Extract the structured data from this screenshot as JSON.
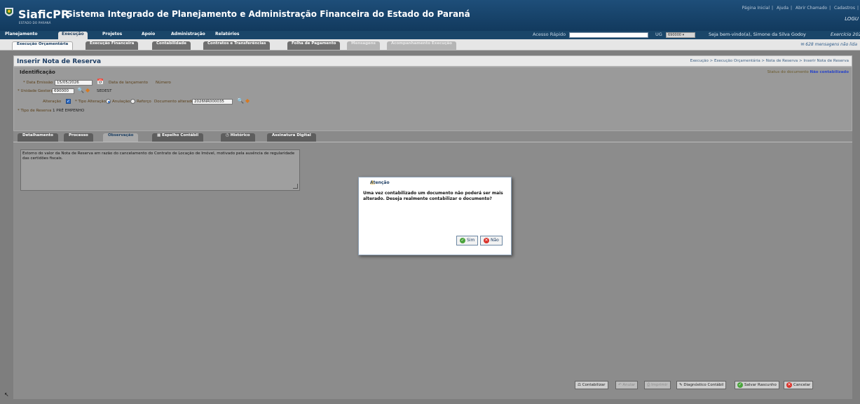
{
  "header": {
    "app_name": "SiaficPR",
    "app_subtitle": "ESTADO DO PARANÁ",
    "system_title": "Sistema Integrado de Planejamento e Administração Financeira do Estado do Paraná",
    "top_links": [
      "Página Inicial",
      "Ajuda",
      "Abrir Chamado",
      "Cadastros"
    ],
    "brand": "LOGU"
  },
  "main_nav": {
    "tabs": [
      {
        "label": "Planejamento"
      },
      {
        "label": "Execução",
        "active": true
      },
      {
        "label": "Projetos"
      },
      {
        "label": "Apoio"
      },
      {
        "label": "Administração"
      },
      {
        "label": "Relatórios"
      }
    ],
    "quick_access_label": "Acesso Rápido",
    "quick_access_value": "",
    "ug_label": "UG",
    "ug_value": "690000",
    "welcome": "Seja bem-vindo(a), Simone da Silva Godoy",
    "exercicio": "Exercício 202"
  },
  "sub_nav": {
    "tabs": [
      {
        "label": "Execução Orçamentária",
        "active": true
      },
      {
        "label": "Execução Financeira"
      },
      {
        "label": "Contabilidade"
      },
      {
        "label": "Contratos e Transferências"
      },
      {
        "label": "Folha de Pagamento"
      },
      {
        "label": "Mensagens",
        "disabled": true
      },
      {
        "label": "Acompanhamento Execução",
        "disabled": true
      }
    ],
    "messages": "628 mensagens não lida"
  },
  "page": {
    "title": "Inserir Nota de Reserva",
    "breadcrumb": "Execução > Execução Orçamentária > Nota de Reserva > Inserir Nota de Reserva"
  },
  "identificacao": {
    "heading": "Identificação",
    "status_label": "Status do documento",
    "status_value": "Não contabilizado",
    "data_emissao_label": "* Data Emissão",
    "data_emissao": "15/05/2026",
    "data_lancamento_label": "Data de lançamento",
    "numero_label": "Número",
    "unidade_gestora_label": "* Unidade Gestora",
    "unidade_gestora_code": "690000",
    "unidade_gestora_name": "SEDEST",
    "alteracao_label": "Alteração",
    "alteracao_checked": true,
    "tipo_alteracao_label": "* Tipo Alteração",
    "anulacao_label": "Anulação",
    "reforco_label": "Reforço",
    "tipo_alteracao_selected": "Anulação",
    "documento_alterado_label": "Documento alterado",
    "documento_alterado": "2026NR000035",
    "tipo_reserva_label": "* Tipo de Reserva",
    "tipo_reserva": "1  PRÉ EMPENHO"
  },
  "detail_tabs": [
    {
      "label": "Detalhamento"
    },
    {
      "label": "Processo"
    },
    {
      "label": "Observação",
      "active": true
    },
    {
      "label": "Espelho Contábil",
      "icon": "grid-icon"
    },
    {
      "label": "Histórico",
      "icon": "history-icon"
    },
    {
      "label": "Assinatura Digital"
    }
  ],
  "observacao_text": "Estorno do valor da Nota de Reserva em razão do cancelamento do Contrato de Locação de Imóvel, motivado pela ausência de regularidade das certidões fiscais.",
  "footer_buttons": [
    {
      "label": "Contabilizar",
      "icon": "ledger-icon"
    },
    {
      "label": "Anular",
      "icon": "undo-icon",
      "disabled": true
    },
    {
      "label": "Imprimir",
      "icon": "print-icon",
      "disabled": true
    },
    {
      "label": "Diagnóstico Contábil",
      "icon": "diagnostic-icon"
    },
    {
      "label": "Salvar Rascunho",
      "icon": "save-icon"
    },
    {
      "label": "Cancelar",
      "icon": "cancel-icon"
    }
  ],
  "dialog": {
    "title": "Atenção",
    "message": "Uma vez contabilizado um documento não poderá ser mais alterado. Deseja realmente contabilizar o documento?",
    "yes_label": "Sim",
    "no_label": "Não"
  },
  "colors": {
    "header_bg": "#1e4e79",
    "status_value": "#2b46c8",
    "dialog_title": "#1d3d63"
  }
}
